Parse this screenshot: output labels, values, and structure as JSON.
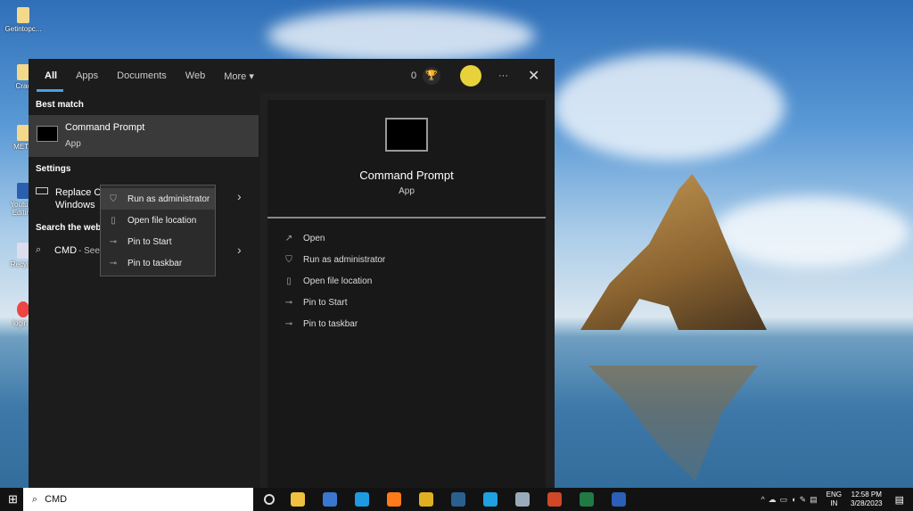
{
  "desktop": {
    "icons": [
      "Getintopc...",
      "Crac",
      "META",
      "Youtube Editing",
      "Recycle",
      "login p"
    ]
  },
  "start": {
    "tabs": [
      "All",
      "Apps",
      "Documents",
      "Web",
      "More"
    ],
    "points": "0",
    "best_match_label": "Best match",
    "best": {
      "title": "Command Prompt",
      "subtitle": "App"
    },
    "settings_label": "Settings",
    "settings_item": {
      "line1": "Replace C",
      "line2": "Windows"
    },
    "web_label": "Search the web",
    "web_item": {
      "query": "CMD",
      "suffix": " - See web results"
    },
    "context_menu": [
      "Run as administrator",
      "Open file location",
      "Pin to Start",
      "Pin to taskbar"
    ],
    "preview": {
      "title": "Command Prompt",
      "subtitle": "App",
      "actions": [
        "Open",
        "Run as administrator",
        "Open file location",
        "Pin to Start",
        "Pin to taskbar"
      ]
    }
  },
  "taskbar": {
    "search_value": "CMD",
    "lang1": "ENG",
    "lang2": "IN",
    "time": "12:58 PM",
    "date": "3/28/2023",
    "apps": [
      {
        "name": "file-explorer",
        "color": "#f0c040"
      },
      {
        "name": "store",
        "color": "#3a78d0"
      },
      {
        "name": "edge",
        "color": "#1e9be0"
      },
      {
        "name": "firefox",
        "color": "#ff7a1a"
      },
      {
        "name": "chrome",
        "color": "#e0b020"
      },
      {
        "name": "terminal",
        "color": "#2a6090"
      },
      {
        "name": "skype",
        "color": "#1fa0e0"
      },
      {
        "name": "notepad",
        "color": "#9ab"
      },
      {
        "name": "powerpoint",
        "color": "#d24726"
      },
      {
        "name": "excel",
        "color": "#1f7a44"
      },
      {
        "name": "word",
        "color": "#2b5fb8"
      }
    ]
  }
}
